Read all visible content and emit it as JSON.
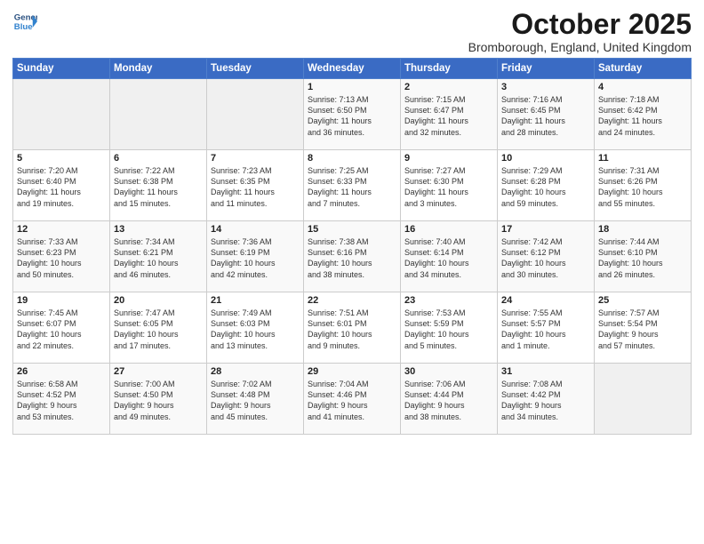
{
  "header": {
    "logo_line1": "General",
    "logo_line2": "Blue",
    "month_title": "October 2025",
    "location": "Bromborough, England, United Kingdom"
  },
  "weekdays": [
    "Sunday",
    "Monday",
    "Tuesday",
    "Wednesday",
    "Thursday",
    "Friday",
    "Saturday"
  ],
  "weeks": [
    [
      {
        "day": "",
        "info": ""
      },
      {
        "day": "",
        "info": ""
      },
      {
        "day": "",
        "info": ""
      },
      {
        "day": "1",
        "info": "Sunrise: 7:13 AM\nSunset: 6:50 PM\nDaylight: 11 hours\nand 36 minutes."
      },
      {
        "day": "2",
        "info": "Sunrise: 7:15 AM\nSunset: 6:47 PM\nDaylight: 11 hours\nand 32 minutes."
      },
      {
        "day": "3",
        "info": "Sunrise: 7:16 AM\nSunset: 6:45 PM\nDaylight: 11 hours\nand 28 minutes."
      },
      {
        "day": "4",
        "info": "Sunrise: 7:18 AM\nSunset: 6:42 PM\nDaylight: 11 hours\nand 24 minutes."
      }
    ],
    [
      {
        "day": "5",
        "info": "Sunrise: 7:20 AM\nSunset: 6:40 PM\nDaylight: 11 hours\nand 19 minutes."
      },
      {
        "day": "6",
        "info": "Sunrise: 7:22 AM\nSunset: 6:38 PM\nDaylight: 11 hours\nand 15 minutes."
      },
      {
        "day": "7",
        "info": "Sunrise: 7:23 AM\nSunset: 6:35 PM\nDaylight: 11 hours\nand 11 minutes."
      },
      {
        "day": "8",
        "info": "Sunrise: 7:25 AM\nSunset: 6:33 PM\nDaylight: 11 hours\nand 7 minutes."
      },
      {
        "day": "9",
        "info": "Sunrise: 7:27 AM\nSunset: 6:30 PM\nDaylight: 11 hours\nand 3 minutes."
      },
      {
        "day": "10",
        "info": "Sunrise: 7:29 AM\nSunset: 6:28 PM\nDaylight: 10 hours\nand 59 minutes."
      },
      {
        "day": "11",
        "info": "Sunrise: 7:31 AM\nSunset: 6:26 PM\nDaylight: 10 hours\nand 55 minutes."
      }
    ],
    [
      {
        "day": "12",
        "info": "Sunrise: 7:33 AM\nSunset: 6:23 PM\nDaylight: 10 hours\nand 50 minutes."
      },
      {
        "day": "13",
        "info": "Sunrise: 7:34 AM\nSunset: 6:21 PM\nDaylight: 10 hours\nand 46 minutes."
      },
      {
        "day": "14",
        "info": "Sunrise: 7:36 AM\nSunset: 6:19 PM\nDaylight: 10 hours\nand 42 minutes."
      },
      {
        "day": "15",
        "info": "Sunrise: 7:38 AM\nSunset: 6:16 PM\nDaylight: 10 hours\nand 38 minutes."
      },
      {
        "day": "16",
        "info": "Sunrise: 7:40 AM\nSunset: 6:14 PM\nDaylight: 10 hours\nand 34 minutes."
      },
      {
        "day": "17",
        "info": "Sunrise: 7:42 AM\nSunset: 6:12 PM\nDaylight: 10 hours\nand 30 minutes."
      },
      {
        "day": "18",
        "info": "Sunrise: 7:44 AM\nSunset: 6:10 PM\nDaylight: 10 hours\nand 26 minutes."
      }
    ],
    [
      {
        "day": "19",
        "info": "Sunrise: 7:45 AM\nSunset: 6:07 PM\nDaylight: 10 hours\nand 22 minutes."
      },
      {
        "day": "20",
        "info": "Sunrise: 7:47 AM\nSunset: 6:05 PM\nDaylight: 10 hours\nand 17 minutes."
      },
      {
        "day": "21",
        "info": "Sunrise: 7:49 AM\nSunset: 6:03 PM\nDaylight: 10 hours\nand 13 minutes."
      },
      {
        "day": "22",
        "info": "Sunrise: 7:51 AM\nSunset: 6:01 PM\nDaylight: 10 hours\nand 9 minutes."
      },
      {
        "day": "23",
        "info": "Sunrise: 7:53 AM\nSunset: 5:59 PM\nDaylight: 10 hours\nand 5 minutes."
      },
      {
        "day": "24",
        "info": "Sunrise: 7:55 AM\nSunset: 5:57 PM\nDaylight: 10 hours\nand 1 minute."
      },
      {
        "day": "25",
        "info": "Sunrise: 7:57 AM\nSunset: 5:54 PM\nDaylight: 9 hours\nand 57 minutes."
      }
    ],
    [
      {
        "day": "26",
        "info": "Sunrise: 6:58 AM\nSunset: 4:52 PM\nDaylight: 9 hours\nand 53 minutes."
      },
      {
        "day": "27",
        "info": "Sunrise: 7:00 AM\nSunset: 4:50 PM\nDaylight: 9 hours\nand 49 minutes."
      },
      {
        "day": "28",
        "info": "Sunrise: 7:02 AM\nSunset: 4:48 PM\nDaylight: 9 hours\nand 45 minutes."
      },
      {
        "day": "29",
        "info": "Sunrise: 7:04 AM\nSunset: 4:46 PM\nDaylight: 9 hours\nand 41 minutes."
      },
      {
        "day": "30",
        "info": "Sunrise: 7:06 AM\nSunset: 4:44 PM\nDaylight: 9 hours\nand 38 minutes."
      },
      {
        "day": "31",
        "info": "Sunrise: 7:08 AM\nSunset: 4:42 PM\nDaylight: 9 hours\nand 34 minutes."
      },
      {
        "day": "",
        "info": ""
      }
    ]
  ]
}
